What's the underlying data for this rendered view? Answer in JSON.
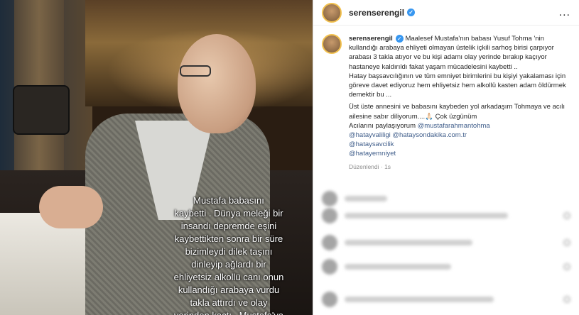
{
  "story": {
    "overlay_text": "Mustafa babasını\nkaybetti . Dünya meleği bir\ninsandı depremde eşini\nkaybettikten sonra bir süre\nbizimleydi dilek taşını\ndinleyip ağlardı bir\nehliyetsiz alkollü canı onun\nkullandığı arabaya vurdu\ntakla attırdı ve olay\nyerinden kaçtı.. Mustafa'ya"
  },
  "post": {
    "username": "serenserengil",
    "more_label": "...",
    "verified_glyph": "✓",
    "caption": {
      "username": "serenserengil",
      "paragraph1": "Maalesef Mustafa'nın babası Yusuf Tohma 'nin kullandığı arabaya ehliyeti olmayan üstelik içkili sarhoş birisi çarpıyor arabası 3 takla atıyor ve bu kişi adamı olay yerinde bırakıp kaçıyor hastaneye kaldırıldı fakat yaşam mücadelesini kaybetti ..",
      "paragraph2": "Hatay başsavcılığının ve tüm emniyet birimlerini bu kişiyi yakalaması için göreve davet ediyoruz hem ehliyetsiz hem alkollü kasten adam öldürmek demektir bu ...",
      "paragraph3a": "Üst üste annesini ve babasını kaybeden yol arkadaşım Tohmaya ve acılı ailesine sabır diliyorum....🙏🏻 Çok üzgünüm",
      "paragraph3b": "Acılarını paylaşıyorum",
      "mention_inline": "@mustafarahmantohma",
      "mentions": [
        "@hatayvaliligi",
        "@hatayvalilig @hatay sondakika.com.tr",
        "@hataysavcilik",
        "@hatayemniyet"
      ]
    },
    "mentions_line2_a": "@hatayvaliligi",
    "mentions_line2_b": "@hataysondakika.com.tr",
    "mention_savcilik": "@hataysavcilik",
    "mention_emniyet": "@hatayemniyet",
    "edited_label": "Düzenlendi · 1s"
  }
}
